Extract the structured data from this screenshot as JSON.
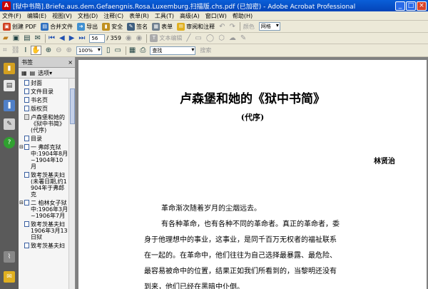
{
  "window": {
    "app_icon": "A",
    "title": "[狱中书简].Briefe.aus.dem.Gefaengnis.Rosa.Luxemburg.扫描版.chs.pdf (已加密) - Adobe Acrobat Professional",
    "minimize": "_",
    "maximize": "□",
    "close": "×"
  },
  "menu": [
    "文件(F)",
    "编辑(E)",
    "视图(V)",
    "文档(D)",
    "注释(C)",
    "表单(R)",
    "工具(T)",
    "高级(A)",
    "窗口(W)",
    "帮助(H)"
  ],
  "toolbar1": {
    "create_pdf": "创建 PDF",
    "combine": "合并文件",
    "export": "导出",
    "secure": "安全",
    "sign": "签名",
    "forms": "表单",
    "review": "审阅和注释",
    "color_label": "颜色",
    "color_value": "网格"
  },
  "toolbar2": {
    "page_current": "56",
    "page_total": "/ 359",
    "text_edit": "文本编辑"
  },
  "toolbar3": {
    "zoom": "100%",
    "search_placeholder": "查找",
    "help_label": "搜索"
  },
  "bookmarks": {
    "header": "书签",
    "options": "选项",
    "items": [
      {
        "toggle": "",
        "label": "封面",
        "grey": false
      },
      {
        "toggle": "",
        "label": "文件目录",
        "grey": false
      },
      {
        "toggle": "",
        "label": "书名页",
        "grey": false
      },
      {
        "toggle": "",
        "label": "版权页",
        "grey": false
      },
      {
        "toggle": "",
        "label": "卢森堡和她的《狱中书简》(代序)",
        "grey": true
      },
      {
        "toggle": "",
        "label": "目录",
        "grey": false
      },
      {
        "toggle": "⊟",
        "label": "一 弗郎克狱中:1904年8月~1904年10月",
        "grey": false
      },
      {
        "toggle": "",
        "label": "致考茨基夫妇(未署日期,约1904年于弗郎克",
        "grey": false
      },
      {
        "toggle": "⊟",
        "label": "二 柏林女子狱中:1906年3月~1906年7月",
        "grey": false
      },
      {
        "toggle": "",
        "label": "致考茨基夫妇 1906年3月13日狱",
        "grey": false
      },
      {
        "toggle": "",
        "label": "致考茨基夫妇",
        "grey": false
      }
    ]
  },
  "document": {
    "title": "卢森堡和她的《狱中书简》",
    "subtitle": "(代序)",
    "author": "林贤治",
    "paragraphs": [
      {
        "indent": true,
        "text": "革命渐次随着岁月的尘烟远去。"
      },
      {
        "indent": true,
        "text": "有各种革命，也有各种不同的革命者。真正的革命者，委"
      },
      {
        "indent": false,
        "text": "身于他理想中的事业，这事业，是同千百万无权者的福祉联系"
      },
      {
        "indent": false,
        "text": "在一起的。在革命中，他们往往为自己选择最暴露、最危险、"
      },
      {
        "indent": false,
        "text": "最容易被命中的位置，结果正如我们所看到的，当黎明还没有"
      },
      {
        "indent": false,
        "text": "到来，他们已经在黑暗中仆倒。"
      }
    ]
  }
}
